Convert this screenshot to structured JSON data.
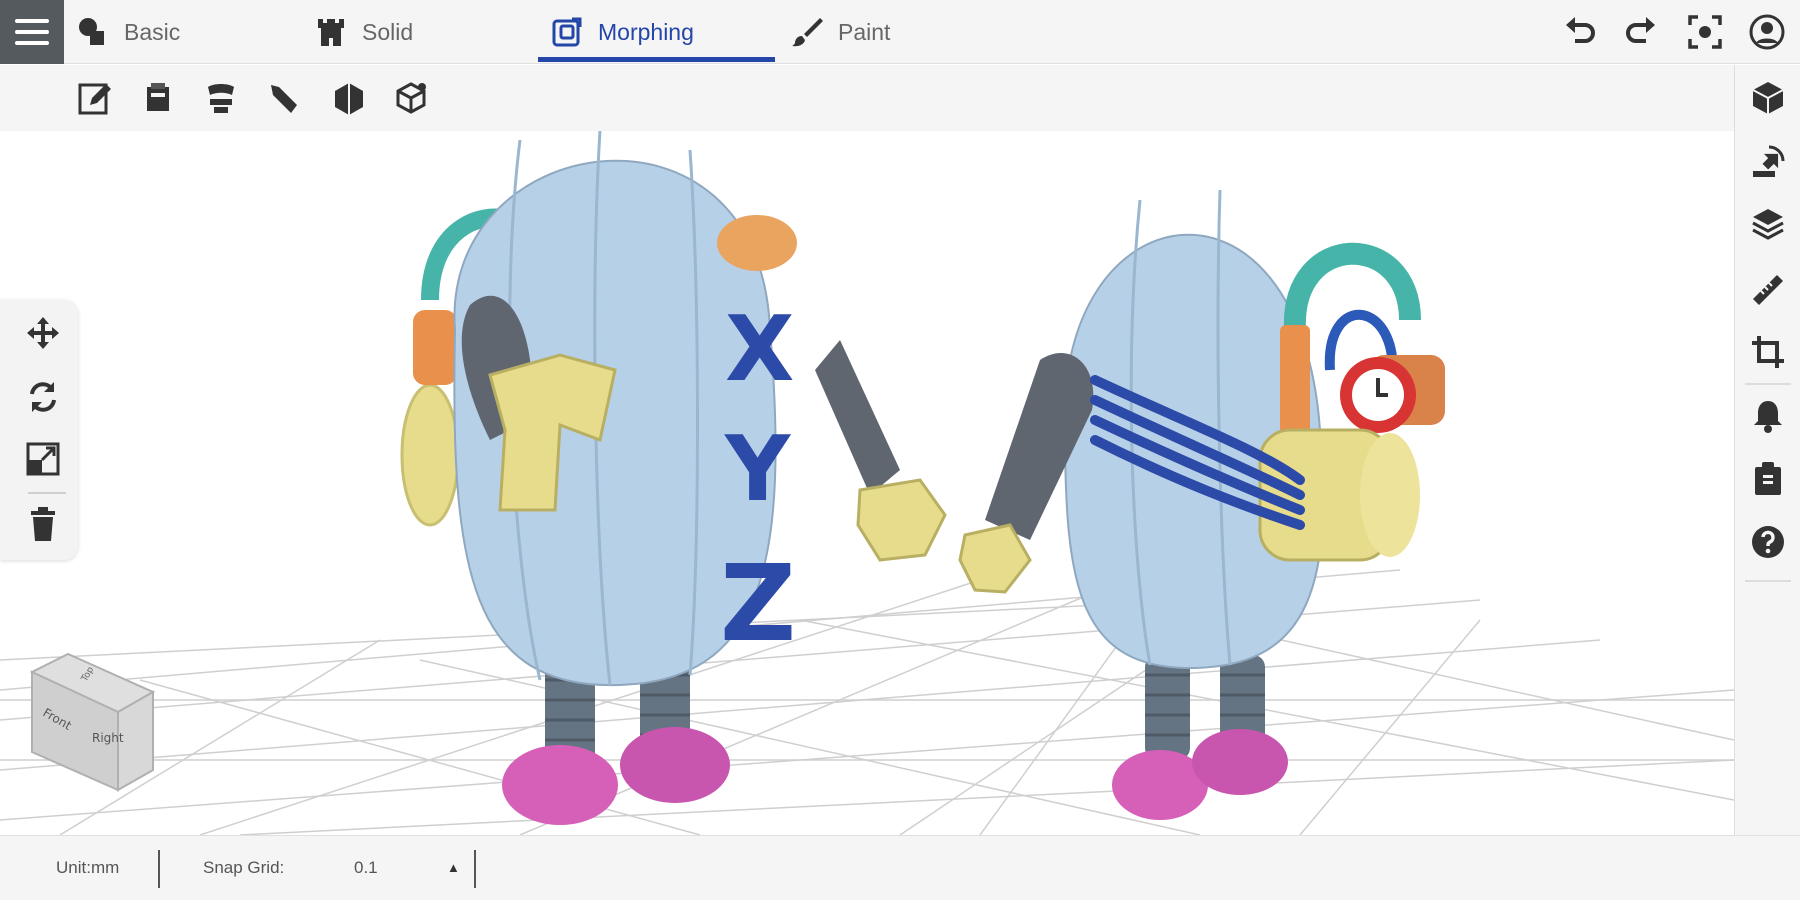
{
  "menu": {
    "icon": "hamburger-menu-icon"
  },
  "tabs": [
    {
      "label": "Basic",
      "icon": "shapes-icon",
      "active": false
    },
    {
      "label": "Solid",
      "icon": "castle-tower-icon",
      "active": false
    },
    {
      "label": "Morphing",
      "icon": "morph-cube-icon",
      "active": true
    },
    {
      "label": "Paint",
      "icon": "paintbrush-icon",
      "active": false
    }
  ],
  "top_actions": [
    "undo-icon",
    "redo-icon",
    "focus-frame-icon",
    "user-account-icon"
  ],
  "toolbar2": [
    "edit-pencil-icon",
    "bucket-icon",
    "morph-deform-icon",
    "bend-icon",
    "extrude-icon",
    "mesh-edit-icon"
  ],
  "right_rail": [
    "cube-view-icon",
    "import-icon",
    "layers-icon",
    "ruler-icon",
    "crop-icon",
    "notification-bell-icon",
    "clipboard-icon",
    "help-icon"
  ],
  "left_panel": [
    "move-arrows-icon",
    "rotate-icon",
    "scale-icon",
    "trash-icon"
  ],
  "view_cube": {
    "top_label": "Top",
    "front_label": "Front",
    "right_label": "Right"
  },
  "models": {
    "letters": [
      "X",
      "Y",
      "Z"
    ]
  },
  "status": {
    "unit_label": "Unit:mm",
    "snap_label": "Snap Grid:",
    "snap_value": "0.1",
    "snap_arrow": "▲"
  },
  "colors": {
    "accent": "#2346a8",
    "topbar_bg": "#f5f5f5",
    "menu_bg": "#555a5e",
    "body_blue": "#b6d0e8",
    "arm_gray": "#5f6670",
    "hand_yellow": "#e6dc8c",
    "shoe_pink": "#d660b8",
    "letters_blue": "#2c4aa8",
    "teal": "#46b4a8",
    "orange": "#e8904c",
    "red": "#d83434"
  }
}
